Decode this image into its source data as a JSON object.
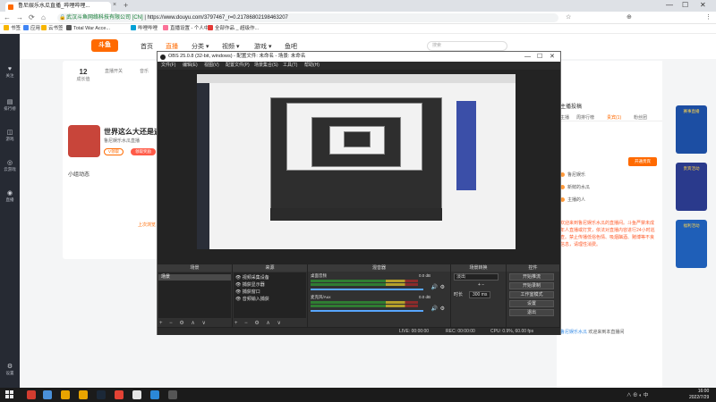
{
  "browser": {
    "tab_title": "鲁尼娱乐水瓜直播_哔哩哔哩...",
    "tab_close": "×",
    "tab_new": "+",
    "window_controls": [
      "—",
      "☐",
      "✕"
    ],
    "nav": [
      "←",
      "→",
      "⟳",
      "⌂"
    ],
    "secure_label": "武汉斗鱼网络科技有限公司 [CN]",
    "url": "https://www.douyu.com/3797467_r=0.21786802198463207",
    "toolbar_icons": [
      "☆",
      "⊕",
      "⋮"
    ]
  },
  "bookmarks": [
    {
      "label": "书签",
      "color": "#f7b500"
    },
    {
      "label": "应用",
      "color": "#4285f4"
    },
    {
      "label": "云书签",
      "color": "#f7b500"
    },
    {
      "label": "Total War Acce...",
      "color": "#555555"
    },
    {
      "label": "哔哩哔哩",
      "color": "#00a1d6"
    },
    {
      "label": "直播设置 - 个人中...",
      "color": "#fb7299"
    },
    {
      "label": "全部作品 _ 超级作...",
      "color": "#e53935"
    }
  ],
  "leftnav": [
    {
      "icon": "♥",
      "label": "关注"
    },
    {
      "icon": "▤",
      "label": "排行榜"
    },
    {
      "icon": "◫",
      "label": "游戏"
    },
    {
      "icon": "◎",
      "label": "云游戏"
    },
    {
      "icon": "◉",
      "label": "直播"
    },
    {
      "icon": "⚙",
      "label": "设置"
    }
  ],
  "site": {
    "logo": "斗鱼",
    "nav": [
      {
        "label": "首页",
        "active": false
      },
      {
        "label": "直播",
        "active": true
      },
      {
        "label": "分类 ▾",
        "active": false
      },
      {
        "label": "视频 ▾",
        "active": false
      },
      {
        "label": "游戏 ▾",
        "active": false
      },
      {
        "label": "鱼吧",
        "active": false
      }
    ],
    "search_placeholder": "搜索"
  },
  "anchor": {
    "stats": [
      {
        "value": "12",
        "label": "成长值"
      },
      {
        "value": "",
        "label": "直播开关"
      },
      {
        "value": "",
        "label": "音乐"
      }
    ],
    "banner_title": "世界这么大还是遇见",
    "banner_sub": "鲁尼娱乐水瓜直播",
    "btn_follow": "V领取",
    "btn_gift": "领取奖励",
    "section_title": "小组动态",
    "side_link": "上次浏览"
  },
  "right": {
    "head": "主播投稿",
    "tabs": [
      "主播",
      "周排行榜",
      "贵宾(1)",
      "粉丝团"
    ],
    "rows": [
      "鲁尼娱乐",
      "新鲜的水瓜",
      "主播的人"
    ],
    "send_gift": "开通贵宾",
    "notice": "欢迎来到鲁尼娱乐水瓜的直播间。斗鱼严禁未成年人直播或打赏，依法对直播内容进行24小时巡查。禁止传播低俗色情、吸烟酗酒、赌博等不良信息，请理性消费。",
    "join_name": "鲁尼娱乐水瓜",
    "join_text": "欢迎来到本直播间"
  },
  "promos": [
    {
      "label": "赛事直播"
    },
    {
      "label": "贵宾活动"
    },
    {
      "label": "福利活动"
    }
  ],
  "obs": {
    "title": "OBS 25.0.8 (32-bit, windows) - 配置文件: 未命名 - 场景: 未命名",
    "window_controls": [
      "—",
      "☐",
      "✕"
    ],
    "menu": [
      "文件(F)",
      "编辑(E)",
      "视图(V)",
      "配置文件(P)",
      "场景集合(S)",
      "工具(T)",
      "帮助(H)"
    ],
    "docks": {
      "scenes": {
        "title": "场景",
        "items": [
          "场景"
        ]
      },
      "sources": {
        "title": "来源",
        "items": [
          "视频采集设备",
          "捕获显示器",
          "捕获窗口",
          "音频输入捕获"
        ]
      },
      "mixer": {
        "title": "混音器",
        "channels": [
          {
            "name": "桌面音频",
            "db": "0.0 dB"
          },
          {
            "name": "麦克风/Aux",
            "db": "0.0 dB"
          }
        ]
      },
      "transitions": {
        "title": "场景转换",
        "selected": "淡出",
        "duration_label": "时长",
        "duration_value": "300 ms"
      },
      "controls": {
        "title": "控件",
        "buttons": [
          "开始推流",
          "开始录制",
          "工作室模式",
          "设置",
          "退出"
        ]
      }
    },
    "status": {
      "live": "LIVE: 00:00:00",
      "rec": "REC: 00:00:00",
      "cpu": "CPU: 0.9%, 60.00 fps"
    },
    "dock_buttons": "+ − ⚙ ∧ ∨"
  },
  "taskbar": {
    "apps": [
      {
        "color": "#d33c2f"
      },
      {
        "color": "#4a90d9"
      },
      {
        "color": "#e8a400"
      },
      {
        "color": "#1b2838"
      },
      {
        "color": "#e34234"
      },
      {
        "color": "#e5e5e5"
      },
      {
        "color": "#2b88d8"
      },
      {
        "color": "#555555"
      }
    ],
    "tray": "∧  ⊕  ◐  中",
    "time": "16:00",
    "date": "2022/7/29"
  }
}
